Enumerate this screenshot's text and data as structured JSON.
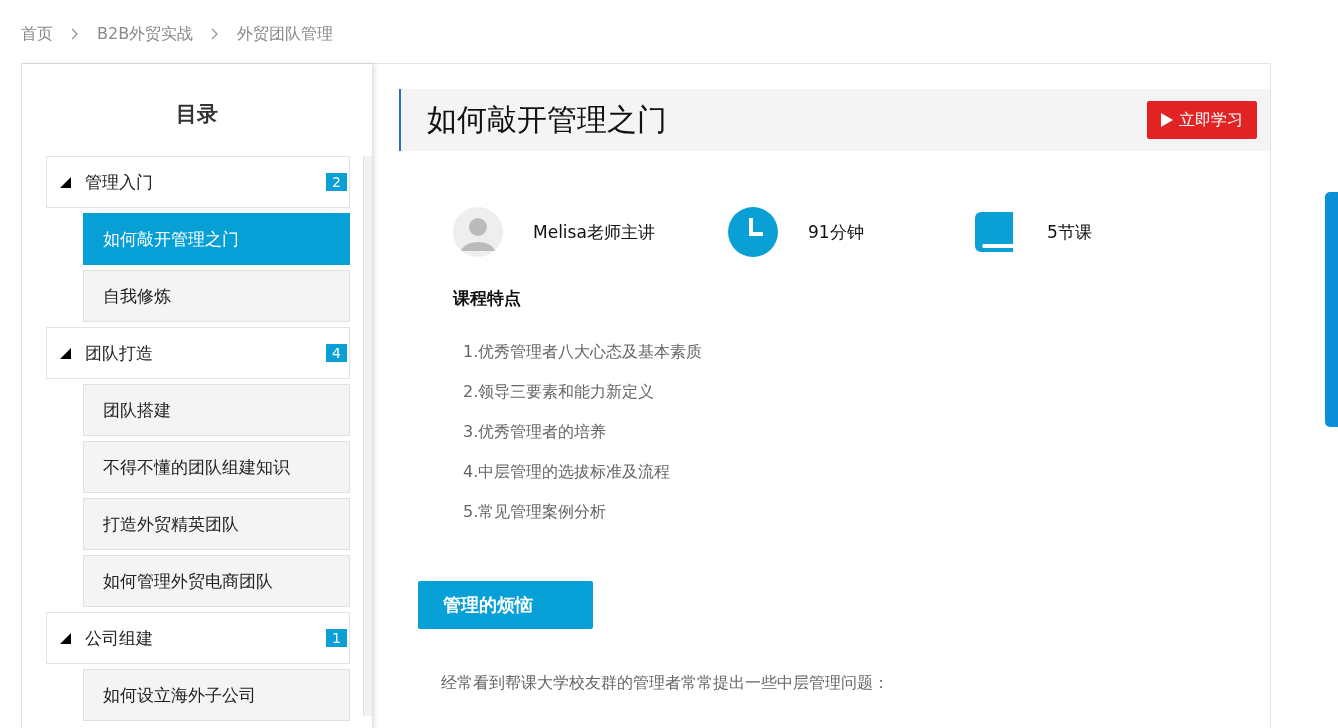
{
  "breadcrumb": [
    {
      "label": "首页"
    },
    {
      "label": "B2B外贸实战"
    },
    {
      "label": "外贸团队管理"
    }
  ],
  "sidebar": {
    "title": "目录",
    "groups": [
      {
        "label": "管理入门",
        "count": "2",
        "expanded": true,
        "items": [
          {
            "label": "如何敲开管理之门",
            "selected": true
          },
          {
            "label": "自我修炼",
            "selected": false
          }
        ]
      },
      {
        "label": "团队打造",
        "count": "4",
        "expanded": true,
        "items": [
          {
            "label": "团队搭建",
            "selected": false
          },
          {
            "label": "不得不懂的团队组建知识",
            "selected": false
          },
          {
            "label": "打造外贸精英团队",
            "selected": false
          },
          {
            "label": "如何管理外贸电商团队",
            "selected": false
          }
        ]
      },
      {
        "label": "公司组建",
        "count": "1",
        "expanded": true,
        "items": [
          {
            "label": "如何设立海外子公司",
            "selected": false
          }
        ]
      }
    ]
  },
  "course": {
    "title": "如何敲开管理之门",
    "start_button": "立即学习",
    "info": [
      {
        "kind": "teacher",
        "text": "Melisa老师主讲"
      },
      {
        "kind": "duration",
        "text": "91分钟"
      },
      {
        "kind": "lessons",
        "text": "5节课"
      }
    ],
    "features_title": "课程特点",
    "features": [
      "1.优秀管理者八大心态及基本素质",
      "2.领导三要素和能力新定义",
      "3.优秀管理者的培养",
      "4.中层管理的选拔标准及流程",
      "5.常见管理案例分析"
    ],
    "section_tab": "管理的烦恼",
    "paragraph": "经常看到帮课大学校友群的管理者常常提出一些中层管理问题："
  }
}
